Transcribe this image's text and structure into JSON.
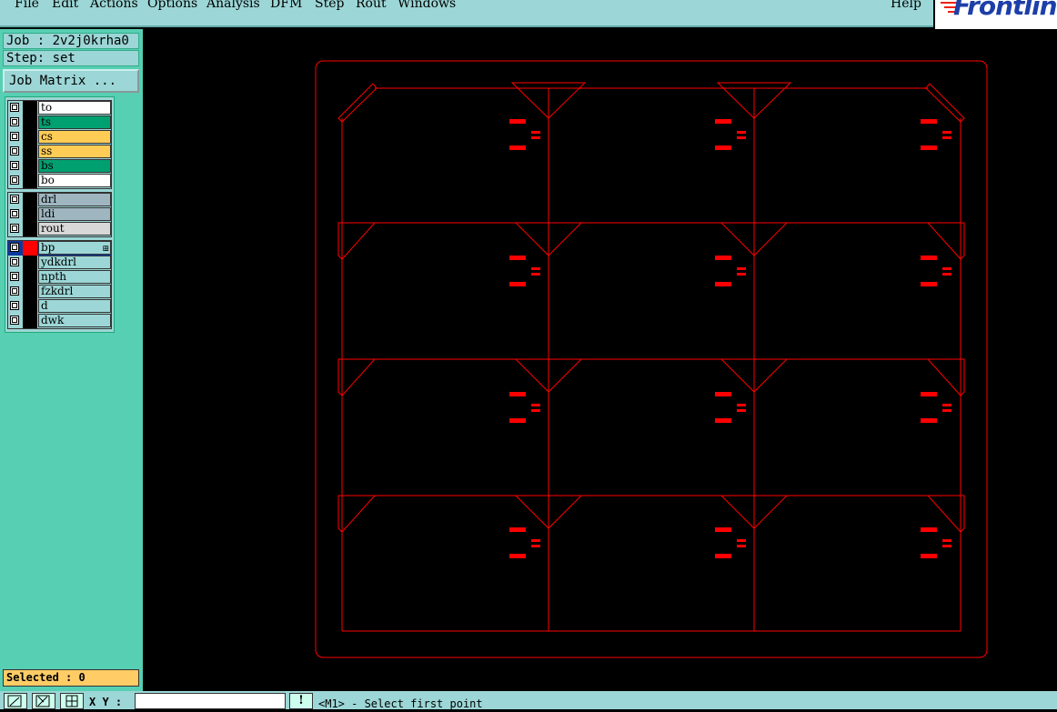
{
  "menu": {
    "file": "File",
    "edit": "Edit",
    "actions": "Actions",
    "options": "Options",
    "analysis": "Analysis",
    "dfm": "DFM",
    "step": "Step",
    "rout": "Rout",
    "windows": "Windows",
    "help": "Help"
  },
  "logo": {
    "text": "Frontline"
  },
  "job": {
    "label": "Job : 2v2j0krha0"
  },
  "step": {
    "label": "Step: set"
  },
  "job_matrix": {
    "label": "Job Matrix ..."
  },
  "layers": {
    "group1": [
      {
        "name": "to",
        "color": "#ffffff"
      },
      {
        "name": "ts",
        "color": "#00a070"
      },
      {
        "name": "cs",
        "color": "#ffcc55"
      },
      {
        "name": "ss",
        "color": "#ffcc55"
      },
      {
        "name": "bs",
        "color": "#00a070"
      },
      {
        "name": "bo",
        "color": "#ffffff"
      }
    ],
    "group2": [
      {
        "name": "drl",
        "color": "#9fb6c0"
      },
      {
        "name": "ldi",
        "color": "#9fb6c0"
      },
      {
        "name": "rout",
        "color": "#d8d8d8"
      }
    ],
    "group3": [
      {
        "name": "bp",
        "color": "#9cd6d6",
        "selected": true
      },
      {
        "name": "ydkdrl",
        "color": "#9cd6d6"
      },
      {
        "name": "npth",
        "color": "#9cd6d6"
      },
      {
        "name": "fzkdrl",
        "color": "#9cd6d6"
      },
      {
        "name": "d",
        "color": "#9cd6d6"
      },
      {
        "name": "dwk",
        "color": "#9cd6d6"
      }
    ]
  },
  "selected": {
    "label": "Selected : 0"
  },
  "coords": {
    "label": "X Y :",
    "value": ""
  },
  "status": {
    "text": "<M1> - Select first point"
  },
  "colors": {
    "feature": "#ff0000",
    "background": "#000000",
    "panel": "#57cfb3"
  }
}
